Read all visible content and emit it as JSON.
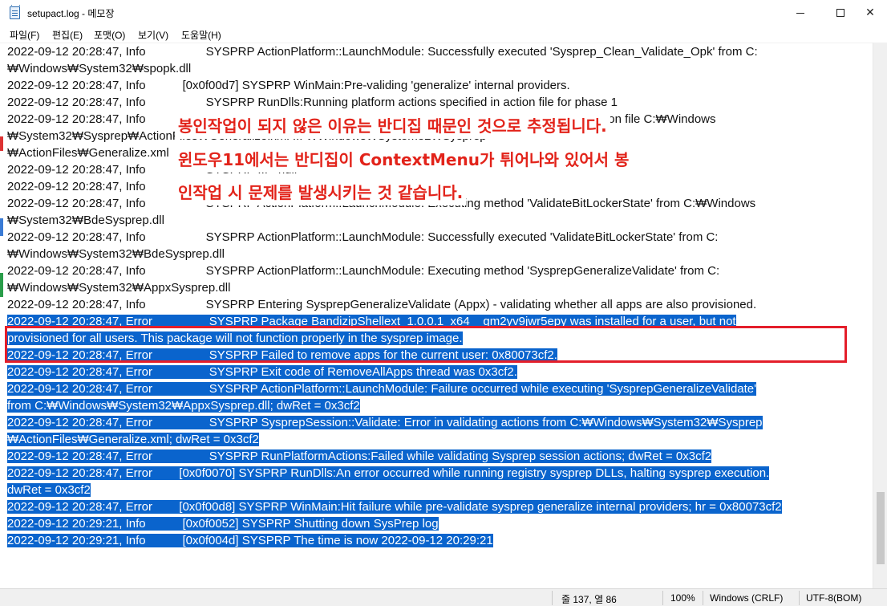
{
  "window": {
    "title": "setupact.log - 메모장",
    "controls": {
      "minimize": "min-icon",
      "maximize": "max-icon",
      "close": "✕"
    }
  },
  "menu": {
    "items": [
      "파일(F)",
      "편집(E)",
      "포맷(O)",
      "보기(V)",
      "도움말(H)"
    ]
  },
  "log_lines": [
    "2022-09-12 20:28:47, Info                  SYSPRP ActionPlatform::LaunchModule: Successfully executed 'Sysprep_Clean_Validate_Opk' from C:",
    "₩Windows₩System32₩spopk.dll",
    "2022-09-12 20:28:47, Info           [0x0f00d7] SYSPRP WinMain:Pre-validing 'generalize' internal providers.",
    "2022-09-12 20:28:47, Info                  SYSPRP RunDlls:Running platform actions specified in action file for phase 1",
    "2022-09-12 20:28:47, Info                  SYSPRP ActionPlatform::LaunchModule: Processing action specified in action file C:₩Windows",
    "₩System32₩Sysprep₩ActionFiles₩Generalize.xml ... ₩Windows₩System32₩Sysprep",
    "₩ActionFiles₩Generalize.xml",
    "2022-09-12 20:28:47, Info                  SYSPRP ... <null>",
    "2022-09-12 20:28:47, Info                  SYSPRP ... registry is AMD64",
    "2022-09-12 20:28:47, Info                  SYSPRP ActionPlatform::LaunchModule: Executing method 'ValidateBitLockerState' from C:₩Windows",
    "₩System32₩BdeSysprep.dll",
    "2022-09-12 20:28:47, Info                  SYSPRP ActionPlatform::LaunchModule: Successfully executed 'ValidateBitLockerState' from C:",
    "₩Windows₩System32₩BdeSysprep.dll",
    "2022-09-12 20:28:47, Info                  SYSPRP ActionPlatform::LaunchModule: Executing method 'SysprepGeneralizeValidate' from C:",
    "₩Windows₩System32₩AppxSysprep.dll",
    "2022-09-12 20:28:47, Info                  SYSPRP Entering SysprepGeneralizeValidate (Appx) - validating whether all apps are also provisioned."
  ],
  "selected_lines": [
    "2022-09-12 20:28:47, Error                 SYSPRP Package BandizipShellext_1.0.0.1_x64__gm2yv9jwr5epy was installed for a user, but not",
    "provisioned for all users. This package will not function properly in the sysprep image.",
    "2022-09-12 20:28:47, Error                 SYSPRP Failed to remove apps for the current user: 0x80073cf2.",
    "2022-09-12 20:28:47, Error                 SYSPRP Exit code of RemoveAllApps thread was 0x3cf2.",
    "2022-09-12 20:28:47, Error                 SYSPRP ActionPlatform::LaunchModule: Failure occurred while executing 'SysprepGeneralizeValidate'",
    "from C:₩Windows₩System32₩AppxSysprep.dll; dwRet = 0x3cf2",
    "2022-09-12 20:28:47, Error                 SYSPRP SysprepSession::Validate: Error in validating actions from C:₩Windows₩System32₩Sysprep",
    "₩ActionFiles₩Generalize.xml; dwRet = 0x3cf2",
    "2022-09-12 20:28:47, Error                 SYSPRP RunPlatformActions:Failed while validating Sysprep session actions; dwRet = 0x3cf2",
    "2022-09-12 20:28:47, Error        [0x0f0070] SYSPRP RunDlls:An error occurred while running registry sysprep DLLs, halting sysprep execution.",
    "dwRet = 0x3cf2",
    "2022-09-12 20:28:47, Error        [0x0f00d8] SYSPRP WinMain:Hit failure while pre-validate sysprep generalize internal providers; hr = 0x80073cf2",
    "2022-09-12 20:29:21, Info           [0x0f0052] SYSPRP Shutting down SysPrep log",
    "2022-09-12 20:29:21, Info           [0x0f004d] SYSPRP The time is now 2022-09-12 20:29:21"
  ],
  "annotation": {
    "lines": [
      "봉인작업이 되지 않은 이유는 반디집 때문인 것으로 추정됩니다.",
      "윈도우11에서는 반디집이 ContextMenu가 튀어나와 있어서 봉",
      "인작업 시 문제를 발생시키는 것 같습니다."
    ],
    "color": "#e2231a"
  },
  "status": {
    "position": "줄 137, 열 86",
    "zoom": "100%",
    "line_ending": "Windows (CRLF)",
    "encoding": "UTF-8(BOM)"
  },
  "colors": {
    "selection": "#0a64cd",
    "highlight_border": "#e41e2a"
  }
}
